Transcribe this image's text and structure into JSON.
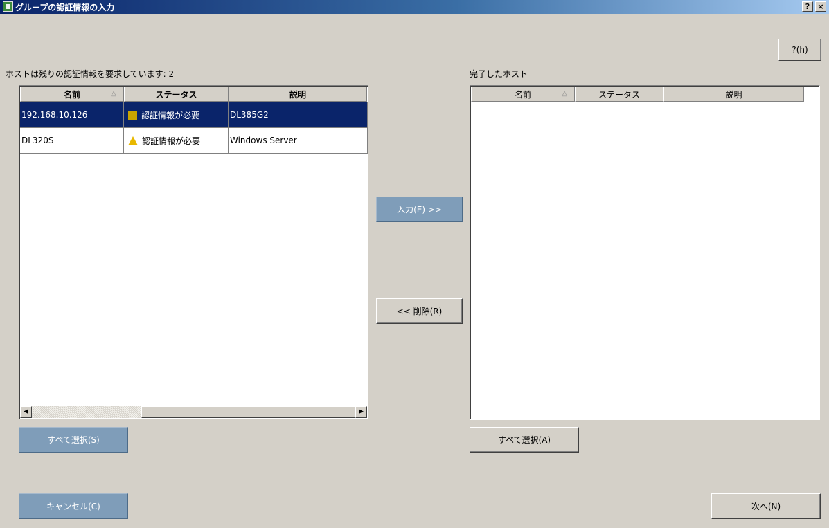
{
  "window": {
    "title": "グループの認証情報の入力",
    "help_title_btn": "?",
    "close_btn": "×"
  },
  "help_button": "?(h)",
  "left": {
    "caption": "ホストは残りの認証情報を要求しています: 2",
    "columns": [
      "名前",
      "ステータス",
      "説明"
    ],
    "rows": [
      {
        "name": "192.168.10.126",
        "status": "認証情報が必要",
        "desc": "DL385G2",
        "selected": true
      },
      {
        "name": "DL320S",
        "status": "認証情報が必要",
        "desc": "Windows Server",
        "selected": false
      }
    ],
    "select_all": "すべて選択(S)"
  },
  "middle": {
    "add": "入力(E) >>",
    "remove": "<< 削除(R)"
  },
  "right": {
    "caption": "完了したホスト",
    "columns": [
      "名前",
      "ステータス",
      "説明"
    ],
    "select_all": "すべて選択(A)"
  },
  "footer": {
    "cancel": "キャンセル(C)",
    "next": "次へ(N)"
  },
  "colors": {
    "title_start": "#0a246a",
    "title_end": "#a6caf0",
    "selection": "#0a246a",
    "warning": "#e8b800"
  }
}
